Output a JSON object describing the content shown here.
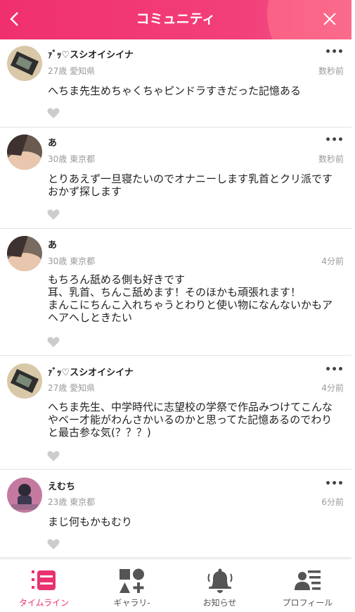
{
  "header": {
    "title": "コミュニティ",
    "back_icon": "chevron-left-icon",
    "close_icon": "close-icon",
    "color": "#f0306e"
  },
  "posts": [
    {
      "name": "ｧﾞｯ♡スシオイシイナ",
      "meta": "27歳 愛知県",
      "time": "数秒前",
      "body": "へちま先生めちゃくちゃピンドラすきだった記憶ある"
    },
    {
      "name": "あ",
      "meta": "30歳 東京都",
      "time": "数秒前",
      "body": "とりあえず一旦寝たいのでオナニーします乳首とクリ派です\nおかず探します"
    },
    {
      "name": "あ",
      "meta": "30歳 東京都",
      "time": "4分前",
      "body": "もちろん舐める側も好きです\n耳、乳首、ちんこ舐めます！そのほかも頑張れます！\nまんこにちんこ入れちゃうとわりと使い物になんないかもア\nヘアへしときたい"
    },
    {
      "name": "ｧﾞｯ♡スシオイシイナ",
      "meta": "27歳 愛知県",
      "time": "4分前",
      "body": "へちま先生、中学時代に志望校の学祭で作品みつけてこんな\nやベー才能がわんさかいるのかと思ってた記憶あるのでわり\nと最古参な気(？？？)"
    },
    {
      "name": "えむち",
      "meta": "23歳 東京都",
      "time": "6分前",
      "body": "まじ何もかもむり"
    }
  ],
  "more_label": "•••",
  "tabs": [
    {
      "label": "タイムライン",
      "icon": "timeline-icon",
      "active": true
    },
    {
      "label": "ギャラリ-",
      "icon": "gallery-icon",
      "active": false
    },
    {
      "label": "お知らせ",
      "icon": "bell-icon",
      "active": false
    },
    {
      "label": "プロフィール",
      "icon": "profile-icon",
      "active": false
    }
  ],
  "colors": {
    "accent": "#e8336f",
    "icon_gray": "#555555",
    "like_gray": "#cccccc"
  }
}
